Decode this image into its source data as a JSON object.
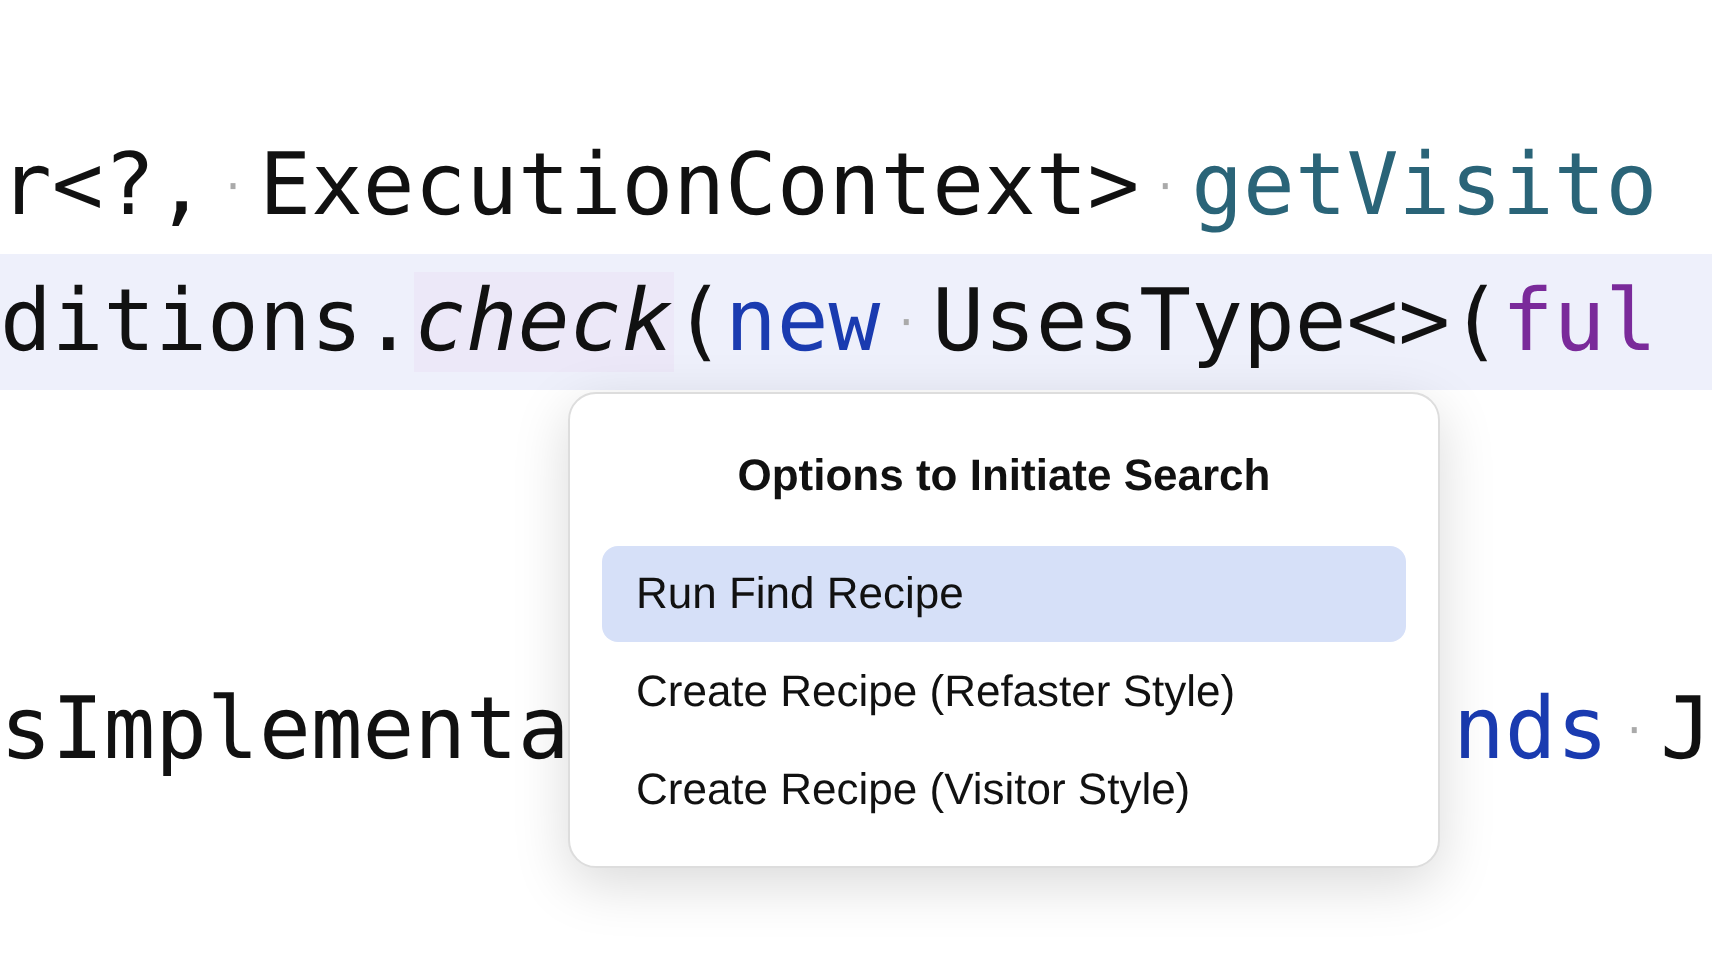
{
  "editor": {
    "lines": [
      {
        "current": false,
        "left": [
          {
            "text": "r<?,",
            "kind": "plain"
          },
          {
            "text": "·",
            "kind": "space"
          },
          {
            "text": "ExecutionContext>",
            "kind": "plain"
          },
          {
            "text": "·",
            "kind": "space"
          },
          {
            "text": "getVisito",
            "kind": "method"
          }
        ]
      },
      {
        "current": true,
        "left": [
          {
            "text": "ditions.",
            "kind": "plain"
          },
          {
            "text": "check",
            "kind": "call",
            "highlighted": true
          },
          {
            "text": "(",
            "kind": "plain"
          },
          {
            "text": "new",
            "kind": "keyword"
          },
          {
            "text": "·",
            "kind": "space"
          },
          {
            "text": "UsesType<>(",
            "kind": "plain"
          },
          {
            "text": "ful",
            "kind": "field"
          }
        ]
      },
      {
        "current": false,
        "left": [
          {
            "text": "sImplementa",
            "kind": "plain"
          }
        ],
        "right": [
          {
            "text": "nds",
            "kind": "keyword"
          },
          {
            "text": "·",
            "kind": "space"
          },
          {
            "text": "J",
            "kind": "plain"
          }
        ]
      }
    ]
  },
  "popup": {
    "title": "Options to Initiate Search",
    "items": [
      {
        "label": "Run Find Recipe",
        "selected": true
      },
      {
        "label": "Create Recipe (Refaster Style)",
        "selected": false
      },
      {
        "label": "Create Recipe (Visitor Style)",
        "selected": false
      }
    ]
  }
}
